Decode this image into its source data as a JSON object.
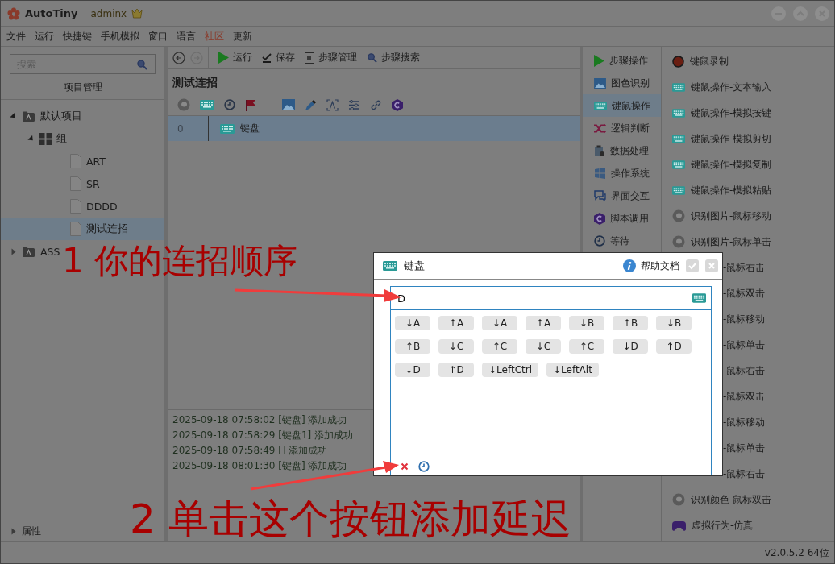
{
  "window": {
    "title": "AutoTiny",
    "user": "adminx"
  },
  "menu": [
    {
      "label": "文件",
      "highlighted": false
    },
    {
      "label": "运行",
      "highlighted": false
    },
    {
      "label": "快捷键",
      "highlighted": false
    },
    {
      "label": "手机模拟",
      "highlighted": false
    },
    {
      "label": "窗口",
      "highlighted": false
    },
    {
      "label": "语言",
      "highlighted": false
    },
    {
      "label": "社区",
      "highlighted": true
    },
    {
      "label": "更新",
      "highlighted": false
    }
  ],
  "project_panel": {
    "search": {
      "placeholder": "搜索"
    },
    "header": "项目管理",
    "tree": [
      {
        "label": "默认项目",
        "kind": "project",
        "expanded": true,
        "selected": false,
        "children": [
          {
            "label": "组",
            "kind": "group",
            "expanded": true,
            "selected": false,
            "children": [
              {
                "label": "ART",
                "kind": "file",
                "selected": false
              },
              {
                "label": "SR",
                "kind": "file",
                "selected": false
              },
              {
                "label": "DDDD",
                "kind": "file",
                "selected": false
              },
              {
                "label": "测试连招",
                "kind": "file",
                "selected": true
              }
            ]
          }
        ]
      },
      {
        "label": "ASS",
        "kind": "project",
        "expanded": false,
        "selected": false
      }
    ],
    "properties": {
      "label": "属性",
      "expanded": false
    }
  },
  "toolbar": [
    {
      "label": "运行",
      "kind": "run"
    },
    {
      "label": "保存",
      "kind": "save"
    },
    {
      "label": "步骤管理",
      "kind": "manage"
    },
    {
      "label": "步骤搜索",
      "kind": "search"
    }
  ],
  "script": {
    "title": "测试连招",
    "steps": [
      {
        "index": "0",
        "label": "键盘",
        "selected": true
      }
    ]
  },
  "log": [
    "2025-09-18 07:58:02 [键盘] 添加成功",
    "2025-09-18 07:58:29 [键盘1] 添加成功",
    "2025-09-18 07:58:49 [] 添加成功",
    "2025-09-18 08:01:30 [键盘] 添加成功"
  ],
  "categories": [
    {
      "label": "步骤操作",
      "kind": "play",
      "selected": false
    },
    {
      "label": "图色识别",
      "kind": "image",
      "selected": false
    },
    {
      "label": "键鼠操作",
      "kind": "keyboard",
      "selected": true
    },
    {
      "label": "逻辑判断",
      "kind": "shuffle",
      "selected": false
    },
    {
      "label": "数据处理",
      "kind": "data",
      "selected": false
    },
    {
      "label": "操作系统",
      "kind": "windows",
      "selected": false
    },
    {
      "label": "界面交互",
      "kind": "chat",
      "selected": false
    },
    {
      "label": "脚本调用",
      "kind": "script",
      "selected": false
    },
    {
      "label": "等待",
      "kind": "clock",
      "selected": false
    }
  ],
  "actions": [
    {
      "label": "键鼠录制",
      "kind": "record"
    },
    {
      "label": "键鼠操作-文本输入",
      "kind": "keyboard"
    },
    {
      "label": "键鼠操作-模拟按键",
      "kind": "keyboard"
    },
    {
      "label": "键鼠操作-模拟剪切",
      "kind": "keyboard"
    },
    {
      "label": "键鼠操作-模拟复制",
      "kind": "keyboard"
    },
    {
      "label": "键鼠操作-模拟粘贴",
      "kind": "keyboard"
    },
    {
      "label": "识别图片-鼠标移动",
      "kind": "mouse"
    },
    {
      "label": "识别图片-鼠标单击",
      "kind": "mouse"
    },
    {
      "label": "-鼠标右击",
      "kind": "covered"
    },
    {
      "label": "-鼠标双击",
      "kind": "covered"
    },
    {
      "label": "-鼠标移动",
      "kind": "covered"
    },
    {
      "label": "-鼠标单击",
      "kind": "covered"
    },
    {
      "label": "-鼠标右击",
      "kind": "covered"
    },
    {
      "label": "-鼠标双击",
      "kind": "covered"
    },
    {
      "label": "-鼠标移动",
      "kind": "covered"
    },
    {
      "label": "-鼠标单击",
      "kind": "covered"
    },
    {
      "label": "-鼠标右击",
      "kind": "covered"
    },
    {
      "label": "识别颜色-鼠标双击",
      "kind": "mouse"
    },
    {
      "label": "虚拟行为-仿真",
      "kind": "gamepad"
    }
  ],
  "dialog": {
    "title": "键盘",
    "help": "帮助文档",
    "value": "D",
    "keys": [
      "↓A",
      "↑A",
      "↓A",
      "↑A",
      "↓B",
      "↑B",
      "↓B",
      "↑B",
      "↓C",
      "↑C",
      "↓C",
      "↑C",
      "↓D",
      "↑D",
      "↓D",
      "↑D",
      "↓LeftCtrl",
      "↓LeftAlt"
    ]
  },
  "annotations": [
    {
      "text": "1 你的连招顺序"
    },
    {
      "text": "2 单击这个按钮添加延迟"
    }
  ],
  "status_bar": {
    "version": "v2.0.5.2 64位"
  }
}
